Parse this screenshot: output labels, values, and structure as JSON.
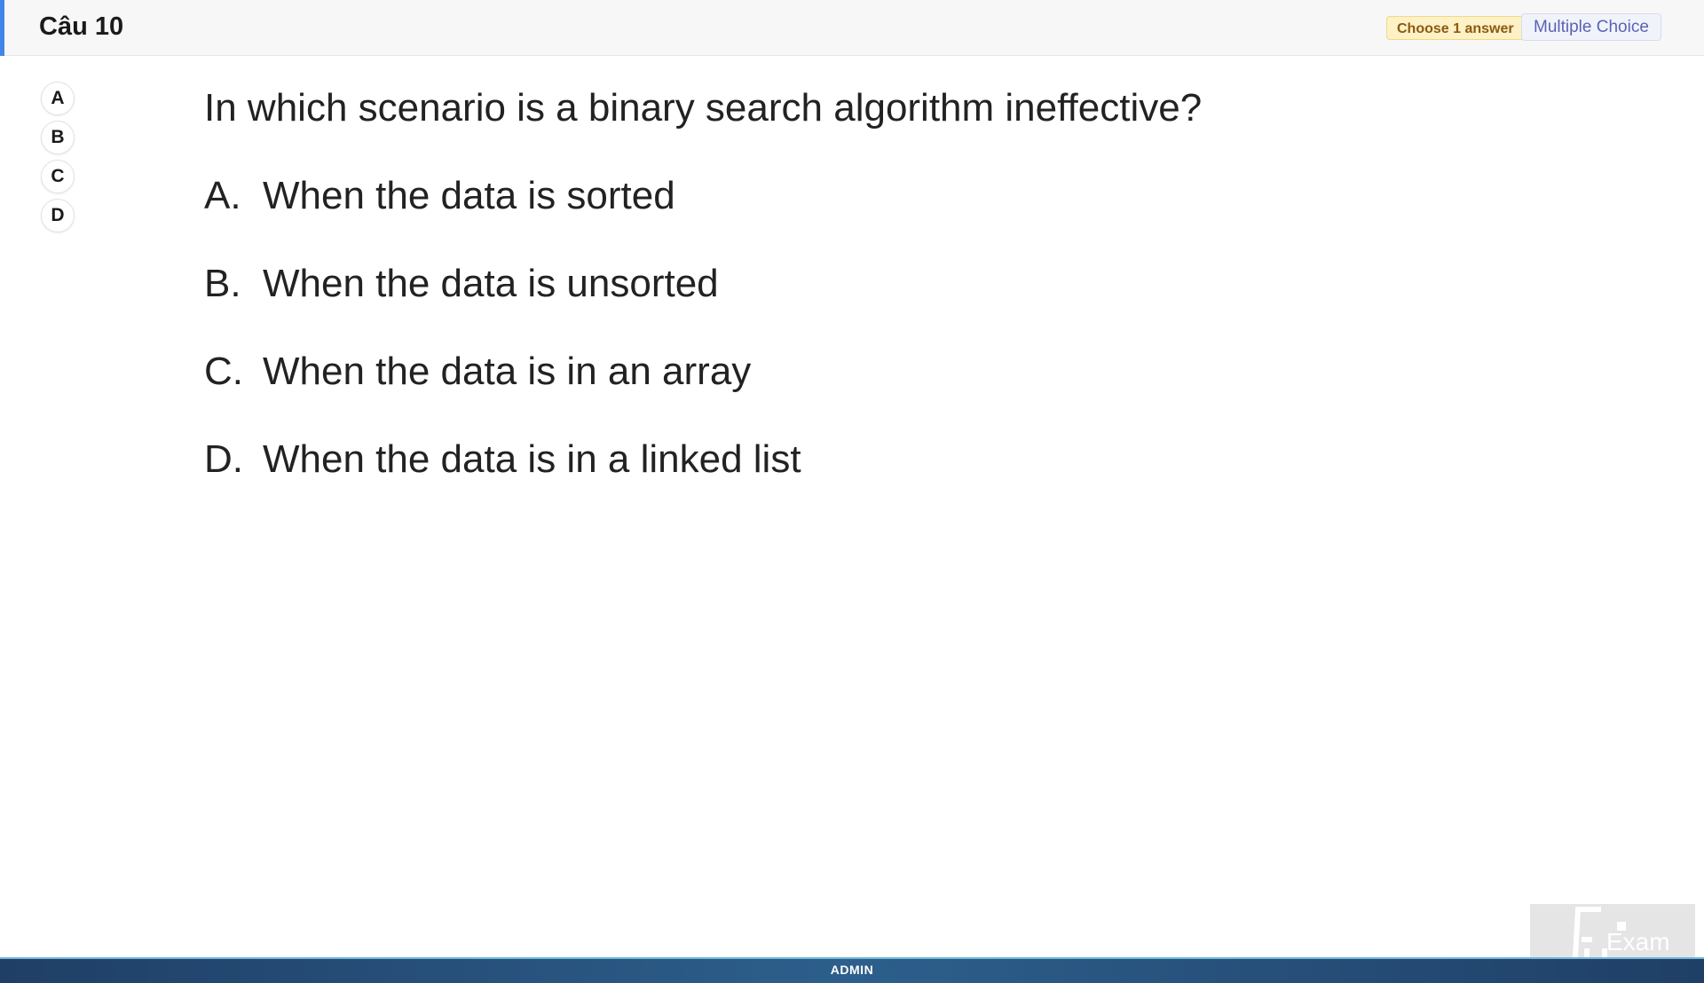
{
  "header": {
    "question_number": "Câu 10",
    "choose_badge": "Choose 1 answer",
    "type_badge": "Multiple Choice",
    "accent_color": "#3f86e6"
  },
  "answer_picker": {
    "options": [
      "A",
      "B",
      "C",
      "D"
    ]
  },
  "question": {
    "text": "In which scenario is a binary search algorithm ineffective?",
    "options": [
      {
        "letter": "A.",
        "text": "When the data is sorted"
      },
      {
        "letter": "B.",
        "text": "When the data is unsorted"
      },
      {
        "letter": "C.",
        "text": "When the data is in an array"
      },
      {
        "letter": "D.",
        "text": "When the data is in a linked list"
      }
    ]
  },
  "footer": {
    "user_label": "ADMIN"
  },
  "watermark": {
    "logo_text": "Exam",
    "logo_icon": "fu-exam-logo-icon"
  }
}
